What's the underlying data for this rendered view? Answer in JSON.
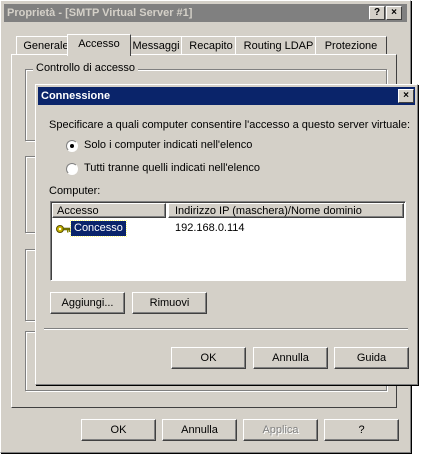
{
  "parent_window": {
    "title": "Proprietà - [SMTP Virtual Server #1]",
    "help_button": "?",
    "close_button": "×",
    "tabs": [
      {
        "label": "Generale"
      },
      {
        "label": "Accesso"
      },
      {
        "label": "Messaggi"
      },
      {
        "label": "Recapito"
      },
      {
        "label": "Routing LDAP"
      },
      {
        "label": "Protezione"
      }
    ],
    "active_tab": "Accesso",
    "group_title": "Controllo di accesso",
    "buttons": {
      "ok": "OK",
      "cancel": "Annulla",
      "apply": "Applica",
      "help": "?"
    }
  },
  "dialog": {
    "title": "Connessione",
    "close_button": "×",
    "instruction": "Specificare a quali computer consentire l'accesso a questo server virtuale:",
    "radio_options": [
      {
        "label": "Solo i computer indicati nell'elenco",
        "selected": true
      },
      {
        "label": "Tutti tranne quelli indicati nell'elenco",
        "selected": false
      }
    ],
    "list_label": "Computer:",
    "columns": [
      "Accesso",
      "Indirizzo IP (maschera)/Nome dominio"
    ],
    "rows": [
      {
        "access": "Concesso",
        "address": "192.168.0.114",
        "icon": "key-icon"
      }
    ],
    "add_button": "Aggiungi...",
    "remove_button": "Rimuovi",
    "ok_button": "OK",
    "cancel_button": "Annulla",
    "help_button": "Guida"
  },
  "colors": {
    "titlebar_active": "#0a246a",
    "titlebar_inactive": "#808080",
    "face": "#d4d0c8",
    "selection": "#0a246a"
  }
}
